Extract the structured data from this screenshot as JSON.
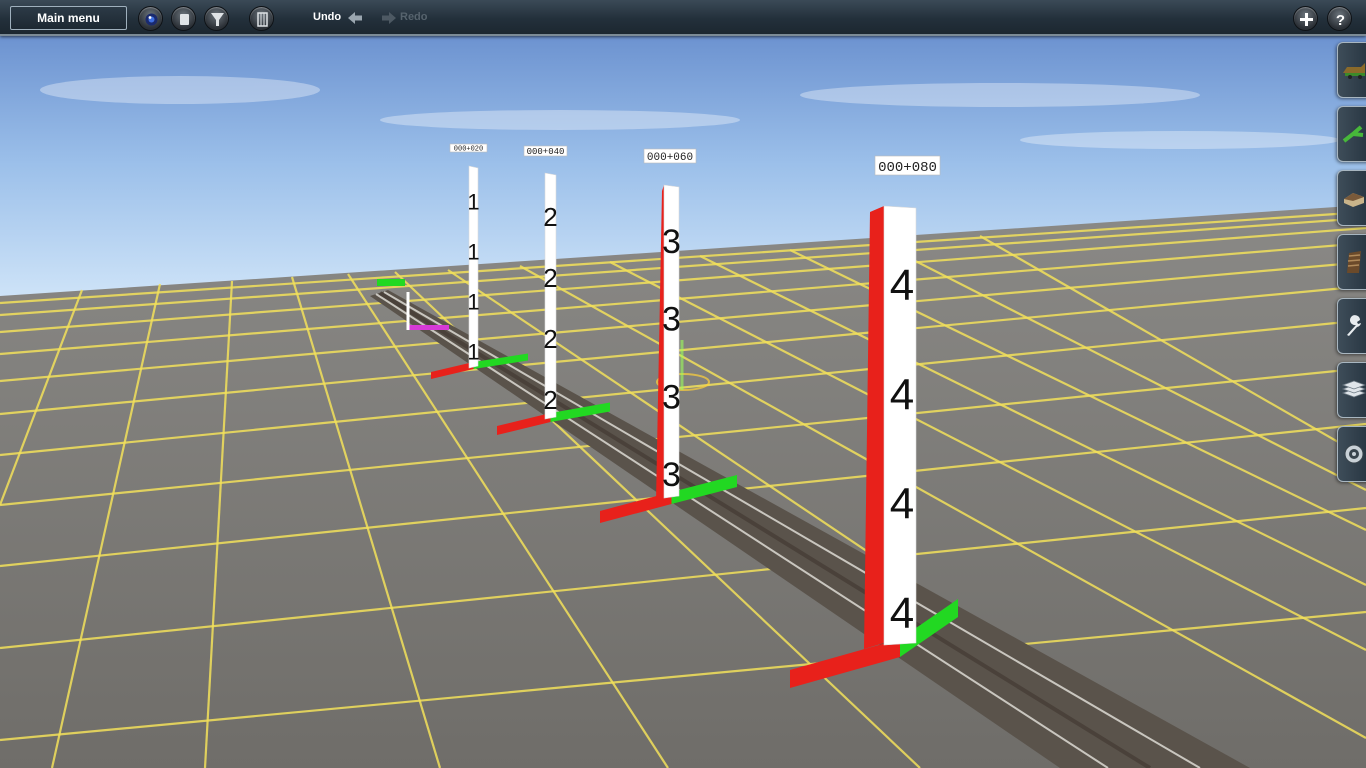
{
  "toolbar": {
    "main_menu_label": "Main menu",
    "undo_label": "Undo",
    "redo_label": "Redo",
    "icons": {
      "camera": "camera-icon",
      "stop": "stop-icon",
      "filter": "filter-icon",
      "layers": "layers-icon",
      "undo": "undo-arrow-icon",
      "redo": "redo-arrow-icon",
      "add": "plus-icon",
      "help": "help-icon"
    }
  },
  "side_panel": {
    "tabs": [
      {
        "name": "trains-tab",
        "icon": "train-icon"
      },
      {
        "name": "track-tab",
        "icon": "track-icon"
      },
      {
        "name": "objects-tab",
        "icon": "building-icon"
      },
      {
        "name": "track-objects-tab",
        "icon": "track-segment-icon"
      },
      {
        "name": "tools-tab",
        "icon": "wrench-icon"
      },
      {
        "name": "layers-tab",
        "icon": "stack-icon"
      },
      {
        "name": "settings-tab",
        "icon": "gear-icon"
      }
    ]
  },
  "scene": {
    "markers": [
      {
        "digit": "1",
        "sign": "000+020"
      },
      {
        "digit": "2",
        "sign": "000+040"
      },
      {
        "digit": "3",
        "sign": "000+060"
      },
      {
        "digit": "4",
        "sign": "000+080"
      }
    ],
    "colors": {
      "sky_top": "#5f86c9",
      "sky_bottom": "#cfe4f8",
      "ground": "#7e7c78",
      "grid_line": "#f2e05a",
      "post_red": "#e8211b",
      "base_green": "#22d822",
      "highlight_magenta": "#d63ad6"
    }
  }
}
